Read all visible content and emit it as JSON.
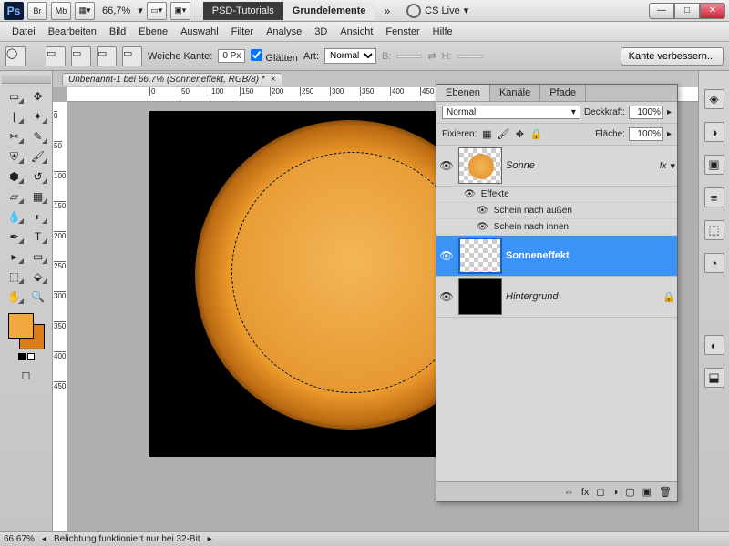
{
  "titlebar": {
    "mini_buttons": [
      "Br",
      "Mb"
    ],
    "zoom": "66,7%",
    "tab1": "PSD-Tutorials",
    "tab2": "Grundelemente",
    "cslive": "CS Live"
  },
  "menubar": [
    "Datei",
    "Bearbeiten",
    "Bild",
    "Ebene",
    "Auswahl",
    "Filter",
    "Analyse",
    "3D",
    "Ansicht",
    "Fenster",
    "Hilfe"
  ],
  "optbar": {
    "feather_label": "Weiche Kante:",
    "feather_value": "0 Px",
    "antialias": "Glätten",
    "style_label": "Art:",
    "style_value": "Normal",
    "width_label": "B:",
    "height_label": "H:",
    "refine": "Kante verbessern..."
  },
  "document": {
    "tab": "Unbenannt-1 bei 66,7% (Sonneneffekt, RGB/8) *",
    "ruler_marks": [
      0,
      50,
      100,
      150,
      200,
      250,
      300,
      350,
      400,
      450
    ]
  },
  "panel": {
    "tabs": [
      "Ebenen",
      "Kanäle",
      "Pfade"
    ],
    "blend_mode": "Normal",
    "opacity_label": "Deckkraft:",
    "opacity": "100%",
    "lock_label": "Fixieren:",
    "fill_label": "Fläche:",
    "fill": "100%",
    "layers": [
      {
        "name": "Sonne",
        "fx": "fx"
      },
      {
        "name": "Sonneneffekt"
      },
      {
        "name": "Hintergrund"
      }
    ],
    "effects_label": "Effekte",
    "effect_outer": "Schein nach außen",
    "effect_inner": "Schein nach innen"
  },
  "status": {
    "zoom": "66,67%",
    "info": "Belichtung funktioniert nur bei 32-Bit"
  },
  "colors": {
    "foreground": "#f2a83f",
    "background_swatch": "#d97c1a",
    "selection_blue": "#3b93f7"
  }
}
